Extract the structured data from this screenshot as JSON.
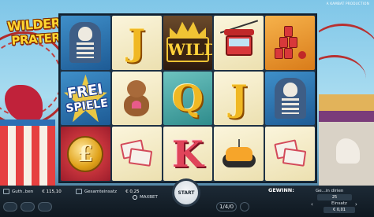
{
  "game": {
    "logo_line1": "WILDER",
    "logo_line2": "PRATER",
    "producer": "A KAMBAT PRODUCTION"
  },
  "reels": [
    [
      {
        "symbol": "skeleton-icon",
        "bg": "blue"
      },
      {
        "symbol": "frei-spiele",
        "bg": "blue",
        "label_line1": "FREI",
        "label_line2": "SPIELE"
      },
      {
        "symbol": "coin-icon",
        "bg": "red",
        "label": "£"
      }
    ],
    [
      {
        "symbol": "letter-j",
        "bg": "cream",
        "label": "J"
      },
      {
        "symbol": "teddy-bear-icon",
        "bg": "cream"
      },
      {
        "symbol": "tickets-icon",
        "bg": "cream"
      }
    ],
    [
      {
        "symbol": "wild",
        "bg": "wild",
        "label": "WILD"
      },
      {
        "symbol": "letter-q",
        "bg": "teal",
        "label": "Q"
      },
      {
        "symbol": "letter-k",
        "bg": "cream",
        "label": "K"
      }
    ],
    [
      {
        "symbol": "gondola-icon",
        "bg": "cream"
      },
      {
        "symbol": "letter-j",
        "bg": "cream",
        "label": "J"
      },
      {
        "symbol": "bumper-car-icon",
        "bg": "cream"
      }
    ],
    [
      {
        "symbol": "cans-icon",
        "bg": "orange"
      },
      {
        "symbol": "skeleton-icon",
        "bg": "blue"
      },
      {
        "symbol": "tickets-icon",
        "bg": "cream"
      }
    ]
  ],
  "bottom": {
    "balance_label": "Guth..ben",
    "balance_value": "€ 115,10",
    "total_bet_label": "Gesamteinsatz",
    "total_bet_value": "€ 0,25",
    "maxbet_label": "MAXBET",
    "start_label": "START",
    "auto_label": "1/4/0",
    "win_label": "GEWINN:",
    "lines_label": "Ge...in dirien",
    "lines_value": "25",
    "bet_label": "Einsatz",
    "bet_value": "€ 0,01"
  },
  "colors": {
    "accent": "#ffd231",
    "bar": "#1d2a36"
  }
}
